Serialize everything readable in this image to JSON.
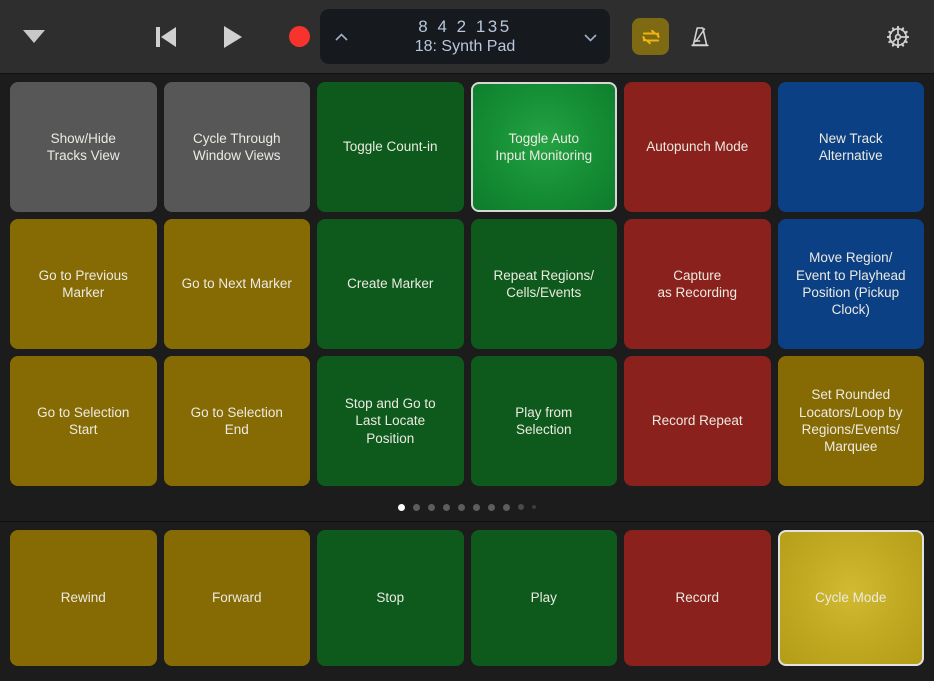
{
  "toolbar": {
    "menu_icon": "caret-down-icon",
    "transport": [
      {
        "name": "go-to-start-button",
        "icon": "skip-to-start-icon"
      },
      {
        "name": "play-button",
        "icon": "play-icon"
      },
      {
        "name": "record-button",
        "icon": "record-icon"
      }
    ],
    "display": {
      "up_chevron": "chevron-up-icon",
      "down_chevron": "chevron-down-icon",
      "position": "8  4  2  135",
      "track": "18: Synth Pad"
    },
    "cycle_button": {
      "name": "cycle-toolbar-button",
      "icon": "cycle-loop-icon",
      "active": true
    },
    "metronome_button": {
      "name": "metronome-toolbar-button",
      "icon": "metronome-icon",
      "active": false
    },
    "settings_button": {
      "name": "settings-button",
      "icon": "gear-icon"
    }
  },
  "colors": {
    "gray": "#575757",
    "green": "#0d5a1c",
    "green_active": "#169036",
    "olive": "#866b04",
    "olive_active": "#c3ab24",
    "red": "#8a211c",
    "blue": "#0b4184",
    "background": "#1c1c1c",
    "toolbar_background": "#2e2e2e",
    "record_red": "#f8332d",
    "cycle_yellow": "#f0b310"
  },
  "pads": {
    "rows": [
      [
        {
          "label": "Show/Hide\nTracks View",
          "color": "c-gray",
          "selected": false
        },
        {
          "label": "Cycle Through\nWindow Views",
          "color": "c-gray",
          "selected": false
        },
        {
          "label": "Toggle Count-in",
          "color": "c-green",
          "selected": false
        },
        {
          "label": "Toggle Auto\nInput Monitoring",
          "color": "c-green-active",
          "selected": true
        },
        {
          "label": "Autopunch Mode",
          "color": "c-red",
          "selected": false
        },
        {
          "label": "New Track\nAlternative",
          "color": "c-blue",
          "selected": false
        }
      ],
      [
        {
          "label": "Go to Previous\nMarker",
          "color": "c-olive",
          "selected": false
        },
        {
          "label": "Go to Next Marker",
          "color": "c-olive",
          "selected": false
        },
        {
          "label": "Create Marker",
          "color": "c-green",
          "selected": false
        },
        {
          "label": "Repeat Regions/\nCells/Events",
          "color": "c-green",
          "selected": false
        },
        {
          "label": "Capture\nas Recording",
          "color": "c-red",
          "selected": false
        },
        {
          "label": "Move Region/\nEvent to Playhead\nPosition (Pickup\nClock)",
          "color": "c-blue",
          "selected": false
        }
      ],
      [
        {
          "label": "Go to Selection\nStart",
          "color": "c-olive",
          "selected": false
        },
        {
          "label": "Go to Selection\nEnd",
          "color": "c-olive",
          "selected": false
        },
        {
          "label": "Stop and Go to\nLast Locate\nPosition",
          "color": "c-green",
          "selected": false
        },
        {
          "label": "Play from\nSelection",
          "color": "c-green",
          "selected": false
        },
        {
          "label": "Record Repeat",
          "color": "c-red",
          "selected": false
        },
        {
          "label": "Set Rounded\nLocators/Loop by\nRegions/Events/\nMarquee",
          "color": "c-olive",
          "selected": false
        }
      ]
    ]
  },
  "page_dots": {
    "count": 10,
    "active_index": 0,
    "sizes": [
      "normal",
      "normal",
      "normal",
      "normal",
      "normal",
      "normal",
      "normal",
      "normal",
      "small",
      "tiny"
    ]
  },
  "bottom_row": [
    {
      "label": "Rewind",
      "color": "c-olive",
      "selected": false
    },
    {
      "label": "Forward",
      "color": "c-olive",
      "selected": false
    },
    {
      "label": "Stop",
      "color": "c-green",
      "selected": false
    },
    {
      "label": "Play",
      "color": "c-green",
      "selected": false
    },
    {
      "label": "Record",
      "color": "c-red",
      "selected": false
    },
    {
      "label": "Cycle Mode",
      "color": "c-olive-active",
      "selected": true
    }
  ]
}
